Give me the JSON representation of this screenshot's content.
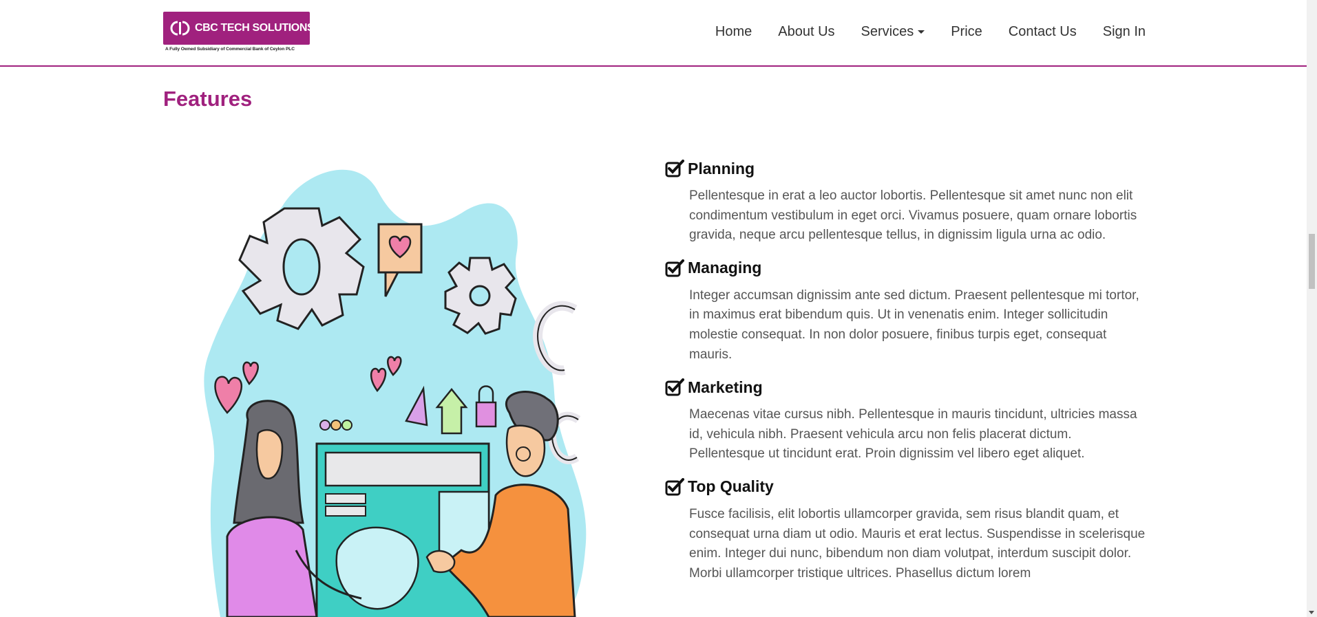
{
  "brand": {
    "name": "CBC TECH SOLUTIONS",
    "tagline": "A Fully Owned Subsidiary of Commercial Bank of Ceylon PLC",
    "color": "#a0217e"
  },
  "nav": {
    "items": [
      {
        "label": "Home"
      },
      {
        "label": "About Us"
      },
      {
        "label": "Services",
        "has_dropdown": true
      },
      {
        "label": "Price"
      },
      {
        "label": "Contact Us"
      },
      {
        "label": "Sign In"
      }
    ]
  },
  "section": {
    "title": "Features"
  },
  "illustration": {
    "icon": "teamwork-illustration"
  },
  "features": [
    {
      "icon": "check-square-icon",
      "title": "Planning",
      "text": "Pellentesque in erat a leo auctor lobortis. Pellentesque sit amet nunc non elit condimentum vestibulum in eget orci. Vivamus posuere, quam ornare lobortis gravida, neque arcu pellentesque tellus, in dignissim ligula urna ac odio."
    },
    {
      "icon": "check-square-icon",
      "title": "Managing",
      "text": "Integer accumsan dignissim ante sed dictum. Praesent pellentesque mi tortor, in maximus erat bibendum quis. Ut in venenatis enim. Integer sollicitudin molestie consequat. In non dolor posuere, finibus turpis eget, consequat mauris."
    },
    {
      "icon": "check-square-icon",
      "title": "Marketing",
      "text": "Maecenas vitae cursus nibh. Pellentesque in mauris tincidunt, ultricies massa id, vehicula nibh. Praesent vehicula arcu non felis placerat dictum. Pellentesque ut tincidunt erat. Proin dignissim vel libero eget aliquet."
    },
    {
      "icon": "check-square-icon",
      "title": "Top Quality",
      "text": "Fusce facilisis, elit lobortis ullamcorper gravida, sem risus blandit quam, et consequat urna diam ut odio. Mauris et erat lectus. Suspendisse in scelerisque enim. Integer dui nunc, bibendum non diam volutpat, interdum suscipit dolor. Morbi ullamcorper tristique ultrices. Phasellus dictum lorem"
    }
  ]
}
